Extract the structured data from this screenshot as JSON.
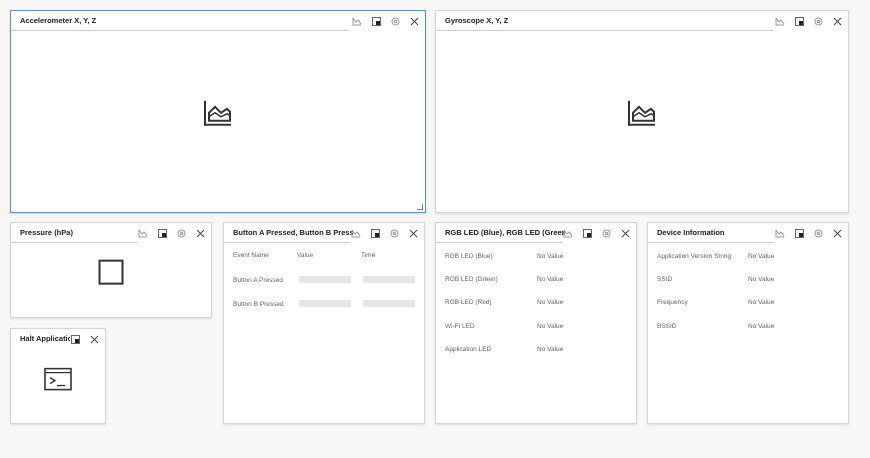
{
  "tiles": {
    "accel": {
      "title": "Accelerometer X, Y, Z"
    },
    "gyro": {
      "title": "Gyroscope X, Y, Z"
    },
    "pressure": {
      "title": "Pressure (hPa)"
    },
    "buttons": {
      "title": "Button A Pressed, Button B Pressed",
      "headers": [
        "Event Name",
        "Value",
        "Time"
      ],
      "rows": [
        "Button A Pressed",
        "Button B Pressed"
      ]
    },
    "rgb": {
      "title": "RGB LED (Blue), RGB LED (Green), RG",
      "rows": [
        {
          "label": "RGB LED (Blue)",
          "value": "No Value"
        },
        {
          "label": "RGB LED (Green)",
          "value": "No Value"
        },
        {
          "label": "RGB LED (Red)",
          "value": "No Value"
        },
        {
          "label": "Wi-Fi LED",
          "value": "No Value"
        },
        {
          "label": "Application LED",
          "value": "No Value"
        }
      ]
    },
    "device": {
      "title": "Device Information",
      "rows": [
        {
          "label": "Application Version String",
          "value": "No Value"
        },
        {
          "label": "SSID",
          "value": "No Value"
        },
        {
          "label": "Frequency",
          "value": "No Value"
        },
        {
          "label": "BSSID",
          "value": "No Value"
        }
      ]
    },
    "halt": {
      "title": "Halt Applicatio"
    }
  },
  "colors": {
    "selected": "#5b8fd6"
  }
}
